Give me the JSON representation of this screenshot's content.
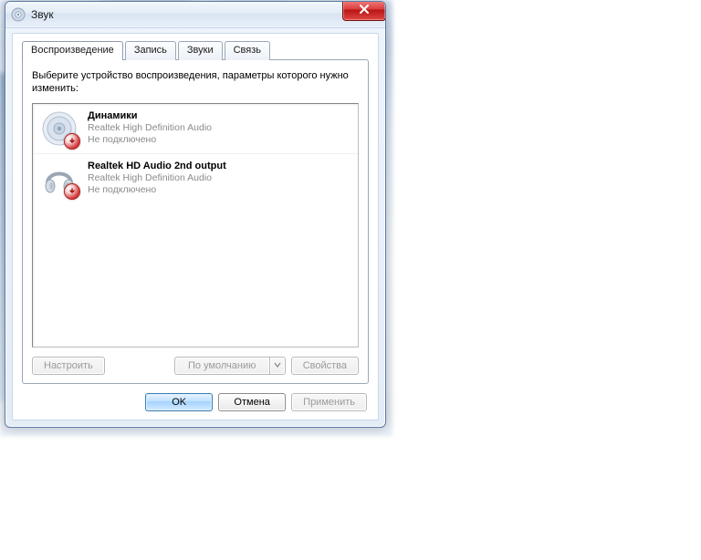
{
  "window": {
    "title": "Звук"
  },
  "tabs": {
    "playback": "Воспроизведение",
    "recording": "Запись",
    "sounds": "Звуки",
    "communications": "Связь"
  },
  "page": {
    "instruction": "Выберите устройство воспроизведения, параметры которого нужно изменить:"
  },
  "devices": [
    {
      "name": "Динамики",
      "driver": "Realtek High Definition Audio",
      "status": "Не подключено",
      "icon": "speaker",
      "badge": "down"
    },
    {
      "name": "Realtek HD Audio 2nd output",
      "driver": "Realtek High Definition Audio",
      "status": "Не подключено",
      "icon": "headphones",
      "badge": "down"
    }
  ],
  "buttons": {
    "configure": "Настроить",
    "set_default": "По умолчанию",
    "properties": "Свойства",
    "ok": "OK",
    "cancel": "Отмена",
    "apply": "Применить"
  }
}
